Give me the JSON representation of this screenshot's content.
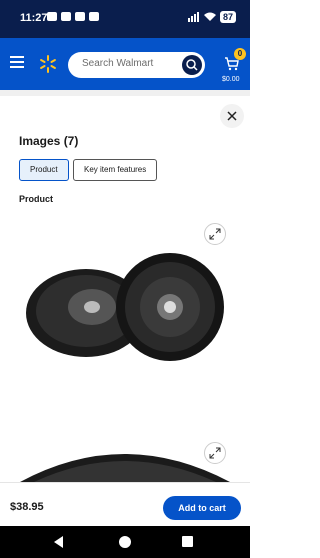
{
  "status_bar": {
    "time": "11:27",
    "battery": "87"
  },
  "header": {
    "search_placeholder": "Search Walmart",
    "cart_count": "0",
    "cart_total": "$0.00"
  },
  "sheet": {
    "title": "Images (7)",
    "tabs": [
      {
        "label": "Product",
        "selected": true
      },
      {
        "label": "Key item features",
        "selected": false
      }
    ],
    "section_label": "Product"
  },
  "footer": {
    "price": "$38.95",
    "add_to_cart_label": "Add to cart"
  },
  "colors": {
    "brand_blue": "#0553c9",
    "dark_navy": "#0a1e4d",
    "spark_yellow": "#ffc220"
  },
  "icons": [
    "menu-icon",
    "spark-logo-icon",
    "search-icon",
    "cart-icon",
    "close-icon",
    "zoom-icon",
    "back-icon",
    "home-icon",
    "recents-icon"
  ]
}
